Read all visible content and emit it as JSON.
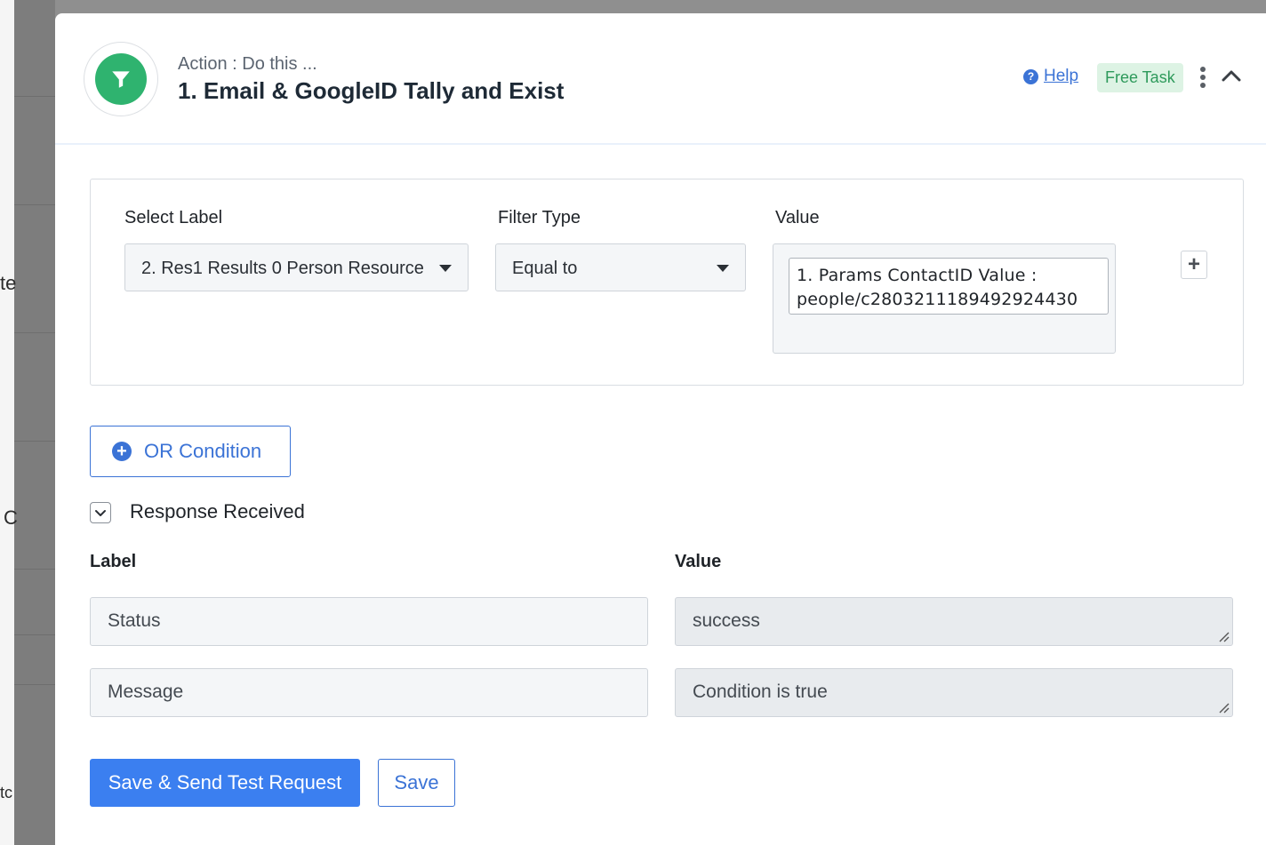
{
  "background": {
    "fragments": [
      "te",
      "C",
      "tc"
    ]
  },
  "header": {
    "subtitle": "Action : Do this ...",
    "title": "1. Email & GoogleID Tally and Exist",
    "help_label": "Help",
    "badge": "Free Task",
    "icon": "filter-icon"
  },
  "filter": {
    "select_label_heading": "Select Label",
    "select_label_value": "2. Res1 Results 0 Person Resource",
    "filter_type_heading": "Filter Type",
    "filter_type_value": "Equal to",
    "value_heading": "Value",
    "value_line1": "1. Params ContactID Value :",
    "value_line2": "people/c2803211189492924430"
  },
  "or_condition": {
    "label": "OR Condition"
  },
  "response": {
    "title": "Response Received",
    "label_heading": "Label",
    "value_heading": "Value",
    "rows": [
      {
        "label": "Status",
        "value": "success"
      },
      {
        "label": "Message",
        "value": "Condition is true"
      }
    ]
  },
  "actions": {
    "primary_label": "Save & Send Test Request",
    "secondary_label": "Save"
  },
  "colors": {
    "accent": "#3b73d6",
    "primary_button": "#3b7ff0",
    "filter_icon_bg": "#2fb36f",
    "badge_bg": "#ddf3e4",
    "badge_text": "#2e9a5b"
  }
}
